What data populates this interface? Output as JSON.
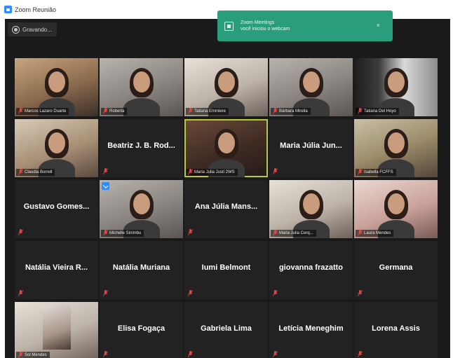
{
  "window": {
    "title": "Zoom Reunião"
  },
  "topbar": {
    "recording_label": "Gravando..."
  },
  "toast": {
    "title": "Zoom Meetings",
    "message": "você iniciou o webcam"
  },
  "colors": {
    "accent": "#2d8cff",
    "toast_bg": "#2a9d7c",
    "active_speaker": "#b7c93a",
    "mute": "#e24a4a",
    "tile_bg": "#222222"
  },
  "participants": [
    {
      "name": "Marcos Lazaro Duarte",
      "video": true,
      "tone": "v-warm"
    },
    {
      "name": "Roberta",
      "video": true,
      "tone": "v-grey"
    },
    {
      "name": "Tatiana Emmiere",
      "video": true,
      "tone": "v-light"
    },
    {
      "name": "Bárbara Mirella",
      "video": true,
      "tone": "v-grey"
    },
    {
      "name": "Tatiana Del Hoyo",
      "video": true,
      "tone": "v-bw"
    },
    {
      "name": "Claudia Borrell",
      "video": true,
      "tone": "v-room"
    },
    {
      "name": "Beatriz J. B. Rod...",
      "video": false
    },
    {
      "name": "Maria Julia Justi 2WS",
      "video": true,
      "tone": "v-dark",
      "active": true
    },
    {
      "name": "Maria Júlia Jun...",
      "video": false
    },
    {
      "name": "Isabella FCFFS",
      "video": true,
      "tone": "v-shelf"
    },
    {
      "name": "Gustavo Gomes...",
      "video": false
    },
    {
      "name": "Michelle Sinimbu",
      "video": true,
      "tone": "v-grey",
      "badge": true
    },
    {
      "name": "Ana Júlia Mans...",
      "video": false
    },
    {
      "name": "Maria Julia Cerq...",
      "video": true,
      "tone": "v-light"
    },
    {
      "name": "Laura Mendes",
      "video": true,
      "tone": "v-pink"
    },
    {
      "name": "Natália Vieira R...",
      "video": false
    },
    {
      "name": "Natália Muriana",
      "video": false
    },
    {
      "name": "Iumi Belmont",
      "video": false
    },
    {
      "name": "giovanna frazatto",
      "video": false
    },
    {
      "name": "Germana",
      "video": false
    },
    {
      "name": "Sol Mendes",
      "video": true,
      "tone": "v-light",
      "small": true
    },
    {
      "name": "Elisa Fogaça",
      "video": false
    },
    {
      "name": "Gabriela Lima",
      "video": false
    },
    {
      "name": "Letícia Meneghim",
      "video": false
    },
    {
      "name": "Lorena Assis",
      "video": false
    }
  ]
}
